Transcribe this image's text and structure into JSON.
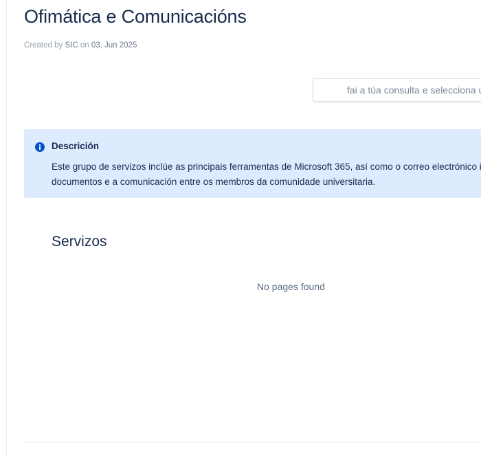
{
  "page": {
    "title": "Ofimática e Comunicacións",
    "byline": {
      "created_by_label": "Created by",
      "author": "SIC",
      "on_label": "on",
      "date": "03, Jun 2025"
    }
  },
  "search": {
    "placeholder": "fai a túa consulta e selecciona unha opción",
    "value": ""
  },
  "info_panel": {
    "icon": "info-icon",
    "title": "Descrición",
    "body_line_1": "Este grupo de servizos inclúe as principais ferramentas de Microsoft 365, así como o correo electrónico institucional, facilitando a xestión de",
    "body_line_2": "documentos e a comunicación entre os membros da comunidade universitaria.",
    "accent_color": "#0052cc",
    "background_color": "#deebff"
  },
  "services": {
    "heading": "Servizos",
    "empty_message": "No pages found"
  }
}
